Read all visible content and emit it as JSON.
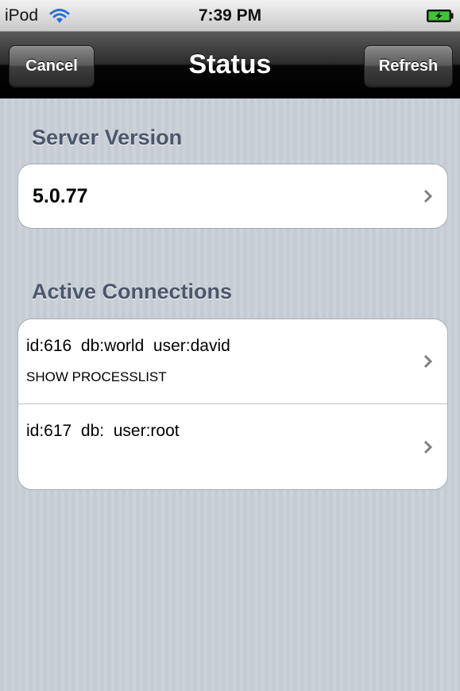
{
  "status_bar": {
    "carrier": "iPod",
    "time": "7:39 PM",
    "wifi_icon": "wifi-icon",
    "battery_icon": "battery-charging-icon"
  },
  "nav_bar": {
    "title": "Status",
    "left_button": "Cancel",
    "right_button": "Refresh"
  },
  "sections": {
    "server": {
      "header": "Server Version",
      "value": "5.0.77"
    },
    "connections": {
      "header": "Active Connections",
      "items": [
        {
          "main": "id:616  db:world  user:david",
          "sub": "SHOW PROCESSLIST"
        },
        {
          "main": "id:617  db:  user:root",
          "sub": ""
        }
      ]
    }
  },
  "colors": {
    "section_header": "#4c566c",
    "background": "#c5ccd4"
  }
}
